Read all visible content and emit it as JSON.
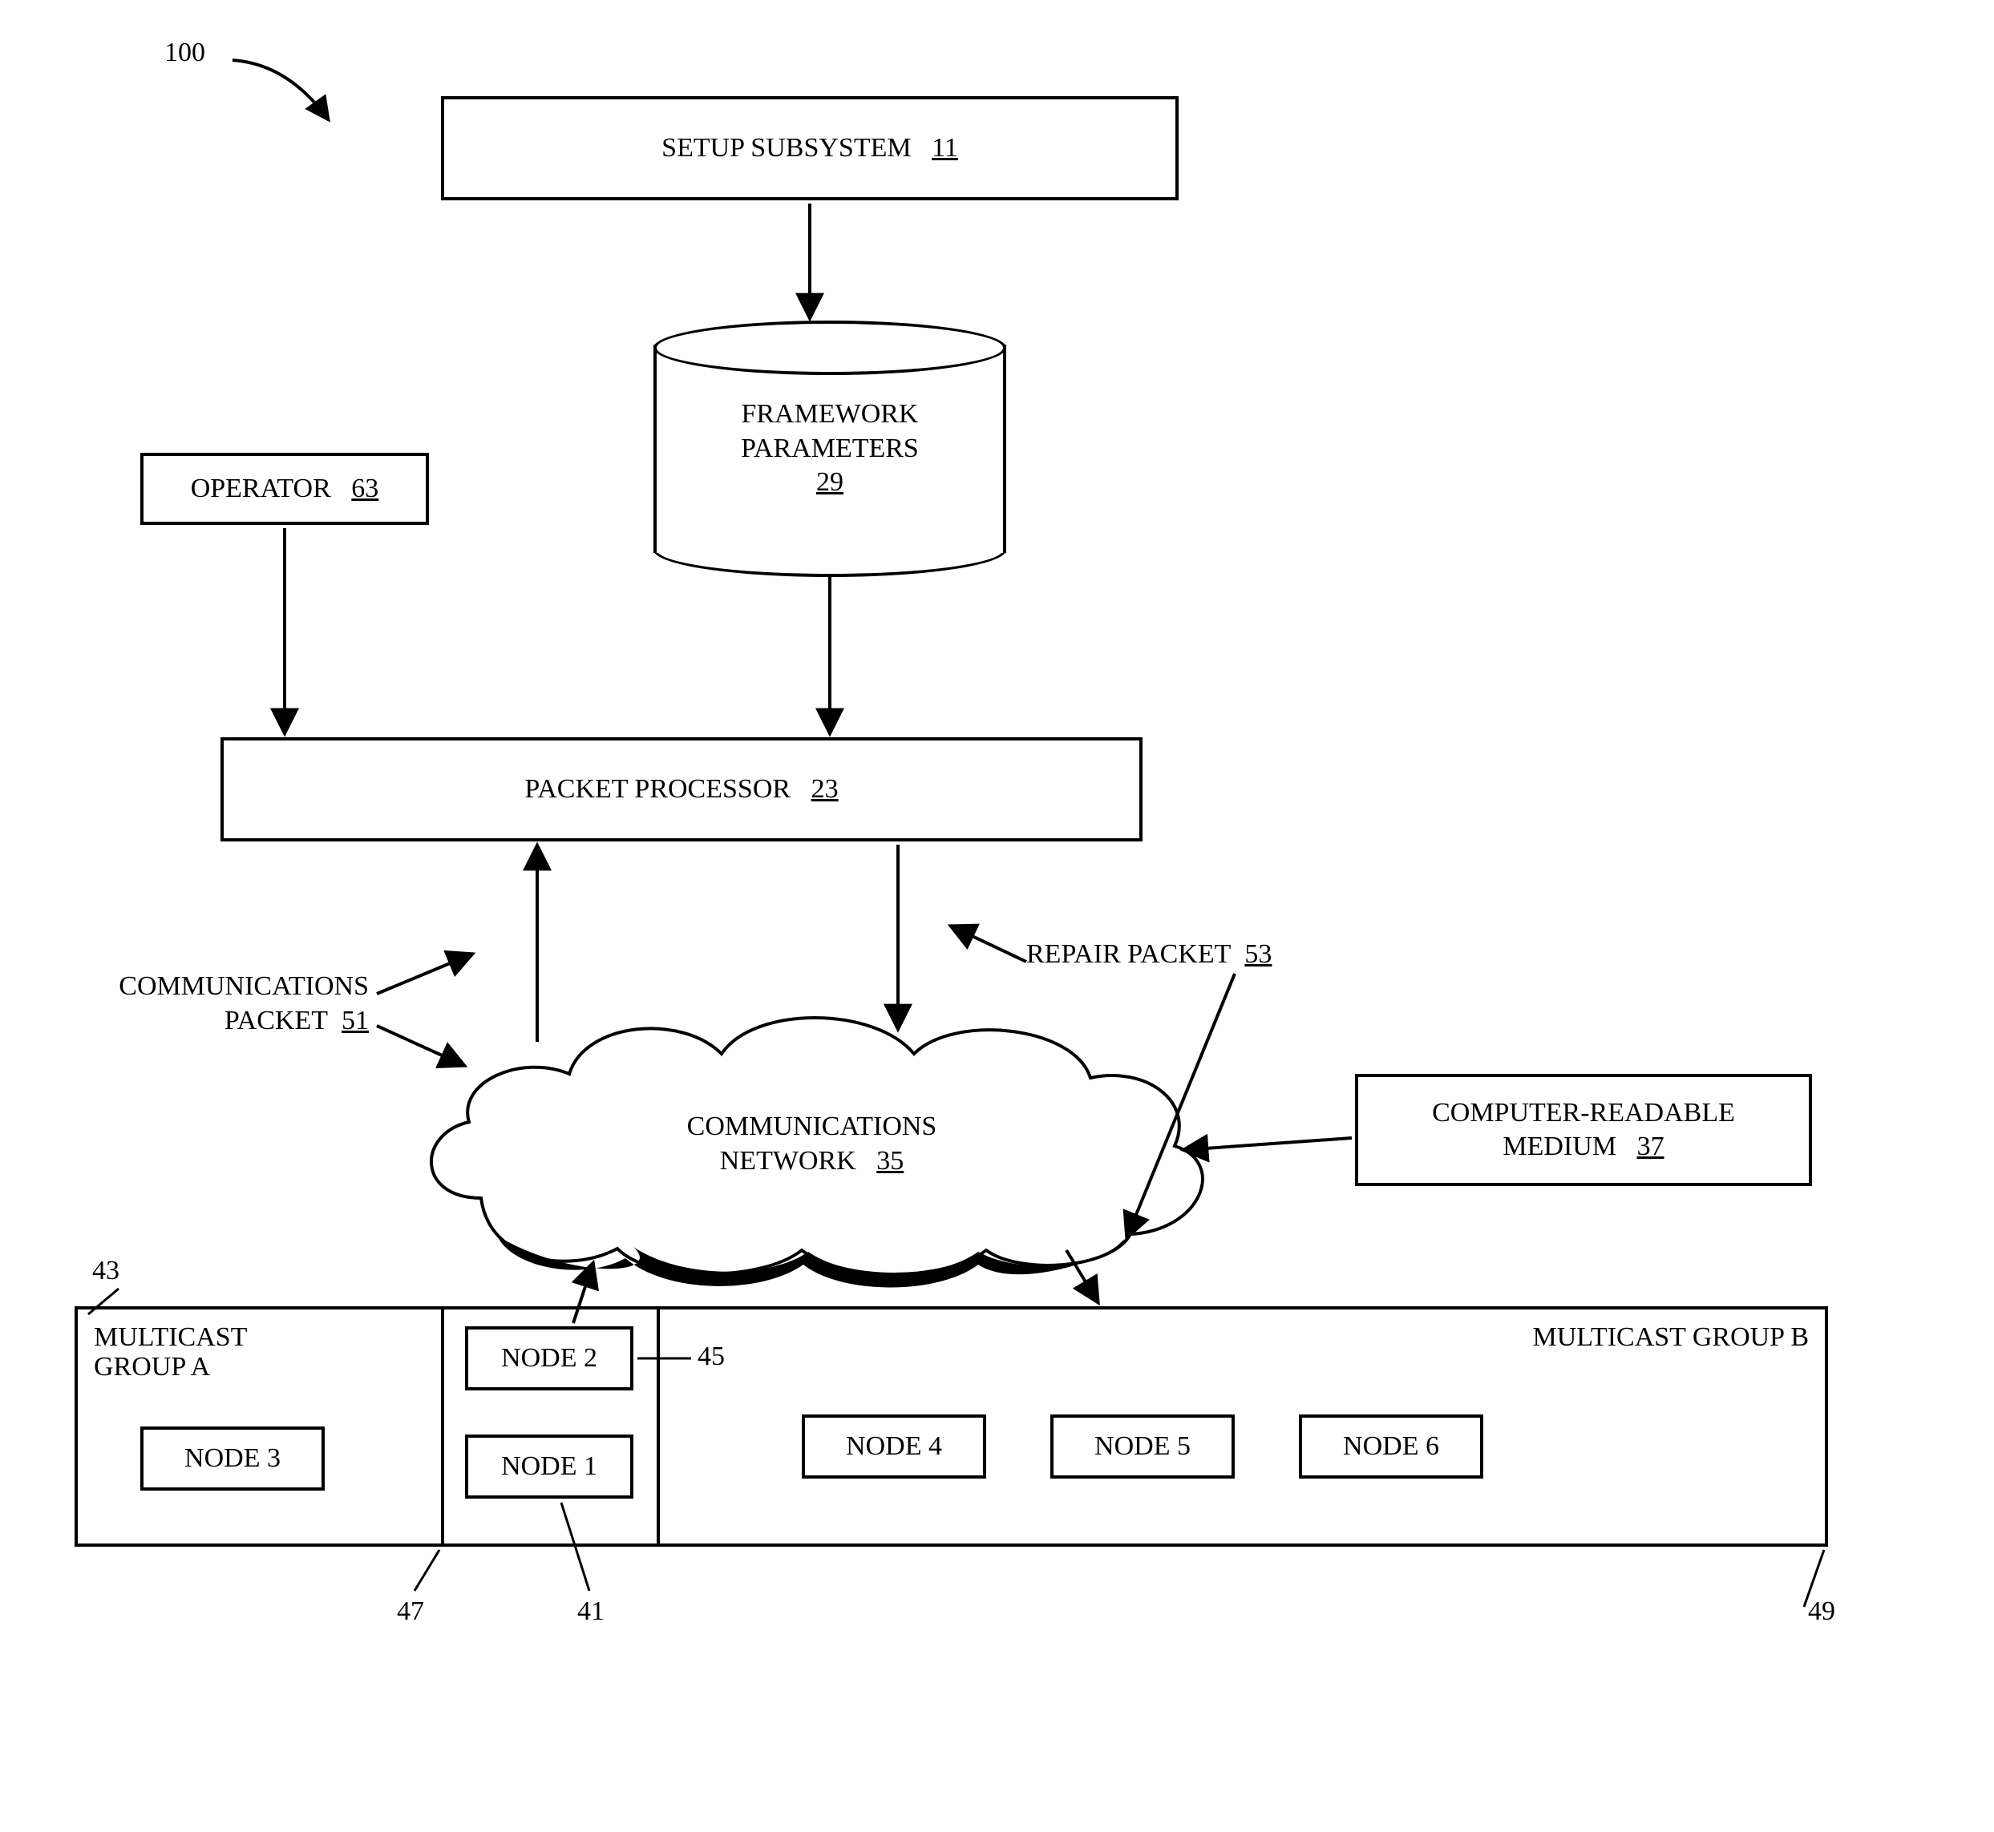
{
  "figure_ref": {
    "number": "100"
  },
  "setup_subsystem": {
    "label": "SETUP SUBSYSTEM",
    "ref": "11"
  },
  "operator": {
    "label": "OPERATOR",
    "ref": "63"
  },
  "framework_params": {
    "line1": "FRAMEWORK",
    "line2": "PARAMETERS",
    "ref": "29"
  },
  "packet_processor": {
    "label": "PACKET PROCESSOR",
    "ref": "23"
  },
  "comm_packet": {
    "line1": "COMMUNICATIONS",
    "line2": "PACKET",
    "ref": "51"
  },
  "repair_packet": {
    "label": "REPAIR  PACKET",
    "ref": "53"
  },
  "comm_network": {
    "line1": "COMMUNICATIONS",
    "line2": "NETWORK",
    "ref": "35"
  },
  "computer_medium": {
    "line1": "COMPUTER-READABLE",
    "line2": "MEDIUM",
    "ref": "37"
  },
  "groups": {
    "a": {
      "title_line1": "MULTICAST",
      "title_line2": "GROUP A",
      "ref": "43"
    },
    "overlap": {
      "ref": "47"
    },
    "b": {
      "title": "MULTICAST GROUP B",
      "ref": "49"
    }
  },
  "nodes": {
    "node1": {
      "label": "NODE 1",
      "ref": "41"
    },
    "node2": {
      "label": "NODE 2",
      "ref": "45"
    },
    "node3": {
      "label": "NODE 3"
    },
    "node4": {
      "label": "NODE 4"
    },
    "node5": {
      "label": "NODE 5"
    },
    "node6": {
      "label": "NODE 6"
    }
  }
}
